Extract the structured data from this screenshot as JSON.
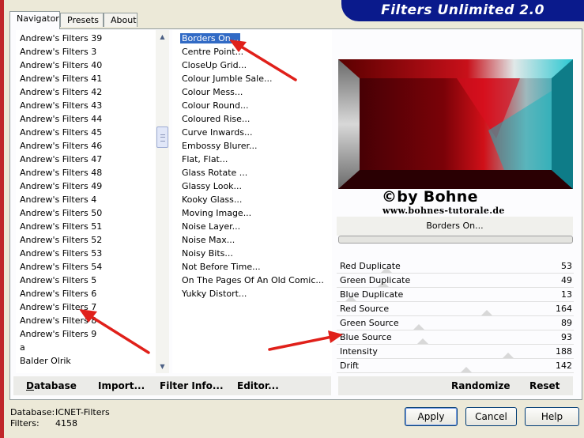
{
  "banner": {
    "title": "Filters Unlimited 2.0"
  },
  "tabs": [
    "Navigator",
    "Presets",
    "About"
  ],
  "categories": [
    "Andrew's Filters 39",
    "Andrew's Filters 3",
    "Andrew's Filters 40",
    "Andrew's Filters 41",
    "Andrew's Filters 42",
    "Andrew's Filters 43",
    "Andrew's Filters 44",
    "Andrew's Filters 45",
    "Andrew's Filters 46",
    "Andrew's Filters 47",
    "Andrew's Filters 48",
    "Andrew's Filters 49",
    "Andrew's Filters 4",
    "Andrew's Filters 50",
    "Andrew's Filters 51",
    "Andrew's Filters 52",
    "Andrew's Filters 53",
    "Andrew's Filters 54",
    "Andrew's Filters 5",
    "Andrew's Filters 6",
    "Andrew's Filters 7",
    "Andrew's Filters 8",
    "Andrew's Filters 9",
    "a",
    "Balder Olrik"
  ],
  "filters": [
    "Borders On...",
    "Centre Point...",
    "CloseUp Grid...",
    "Colour Jumble Sale...",
    "Colour Mess...",
    "Colour Round...",
    "Coloured Rise...",
    "Curve Inwards...",
    "Embossy Blurer...",
    "Flat, Flat...",
    "Glass Rotate ...",
    "Glassy Look...",
    "Kooky Glass...",
    "Moving Image...",
    "Noise Layer...",
    "Noise Max...",
    "Noisy Bits...",
    "Not Before Time...",
    "On The Pages Of An Old Comic...",
    "Yukky Distort..."
  ],
  "selected_filter_index": 0,
  "preview": {
    "credit_line1": "©by Bohne",
    "credit_line2": "www.bohnes-tutorale.de"
  },
  "current_filter": "Borders On...",
  "params": [
    {
      "label": "Red Duplicate",
      "value": "53"
    },
    {
      "label": "Green Duplicate",
      "value": "49"
    },
    {
      "label": "Blue Duplicate",
      "value": "13"
    },
    {
      "label": "Red Source",
      "value": "164"
    },
    {
      "label": "Green Source",
      "value": "89"
    },
    {
      "label": "Blue Source",
      "value": "93"
    },
    {
      "label": "Intensity",
      "value": "188"
    },
    {
      "label": "Drift",
      "value": "142"
    }
  ],
  "bottom_buttons": {
    "database": "Database",
    "import": "Import...",
    "filter_info": "Filter Info...",
    "editor": "Editor...",
    "randomize": "Randomize",
    "reset": "Reset"
  },
  "status": {
    "database_label": "Database:",
    "database_value": "ICNET-Filters",
    "filters_label": "Filters:",
    "filters_value": "4158"
  },
  "dialog_buttons": {
    "apply": "Apply",
    "cancel": "Cancel",
    "help": "Help"
  },
  "colors": {
    "banner": "#0a1a8c",
    "selection": "#316ac5",
    "arrow": "#e0201a"
  }
}
